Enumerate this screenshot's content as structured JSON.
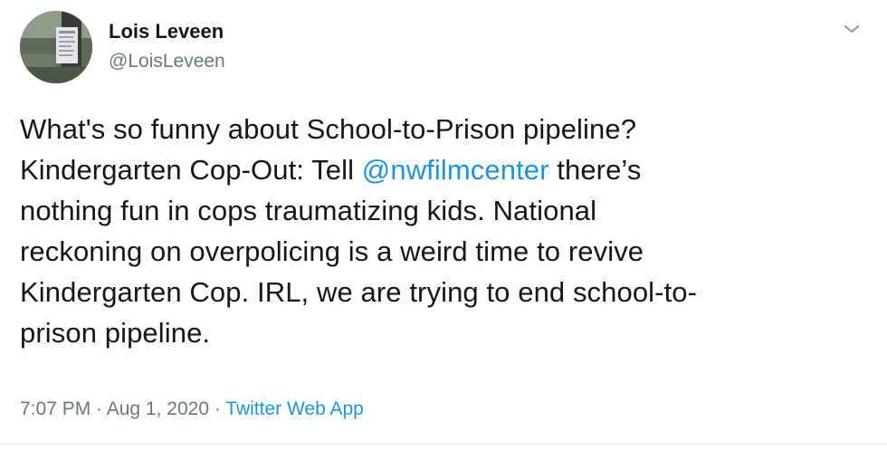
{
  "author": {
    "name": "Lois Leveen",
    "handle": "@LoisLeveen"
  },
  "tweet": {
    "line1": "What's so funny about School-to-Prison pipeline?",
    "line2_before": "Kindergarten Cop-Out: Tell ",
    "mention": "@nwfilmcenter",
    "line2_after": " there’s",
    "line3": "nothing fun in cops traumatizing kids. National",
    "line4": "reckoning on overpolicing is a weird time to revive",
    "line5": "Kindergarten Cop. IRL, we are trying to end school-to-",
    "line6": "prison pipeline."
  },
  "meta": {
    "time": "7:07 PM",
    "separator1": " · ",
    "date": "Aug 1, 2020",
    "separator2": " · ",
    "source": "Twitter Web App"
  },
  "icons": {
    "menu": "chevron-down-icon"
  },
  "colors": {
    "link": "#1b95e0",
    "secondary_text": "#657786",
    "primary_text": "#14171a",
    "divider": "#e6ecf0"
  }
}
